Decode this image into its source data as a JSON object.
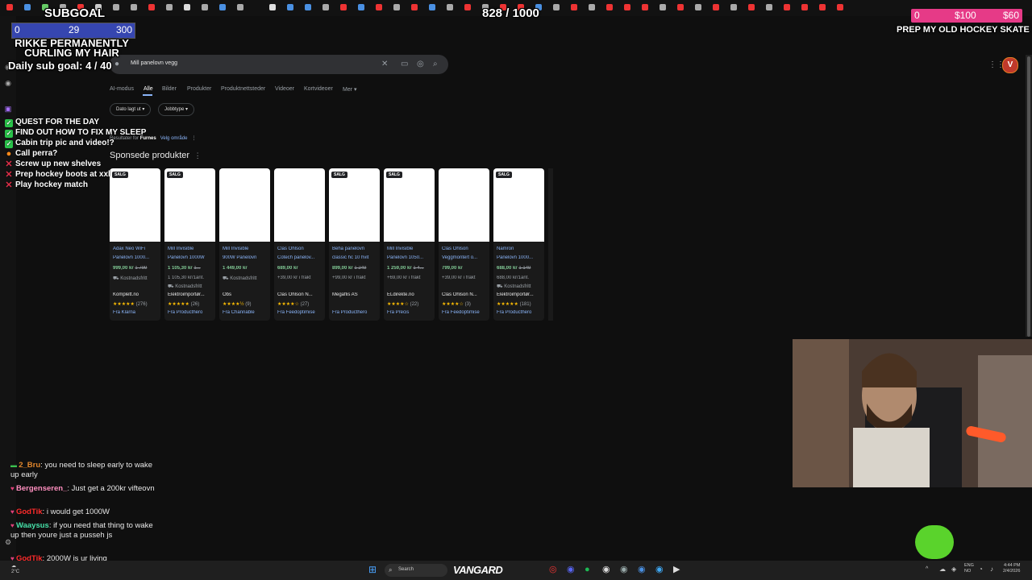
{
  "stream_overlay": {
    "subgoal_title": "SUBGOAL",
    "subgoal_start": "0",
    "subgoal_current": "29",
    "subgoal_target": "300",
    "subgoal_desc": "RIKKE PERMANENTLY CURLING MY HAIR",
    "daily_sub_goal": "Daily sub goal: 4 / 40",
    "counter": "828 / 1000",
    "donation_start": "0",
    "donation_current": "$100",
    "donation_target": "$60",
    "donation_goal_text": "PREP MY OLD HOCKEY SKATE"
  },
  "search": {
    "query": "Mill panelovn vegg",
    "tabs": [
      "AI-modus",
      "Alle",
      "Bilder",
      "Produkter",
      "Produktnettsteder",
      "Videoer",
      "Kortvideoer",
      "Mer"
    ],
    "active_tab": "Alle",
    "filters": [
      "Dato lagt ut",
      "Jobbtype"
    ],
    "location_prefix": "Resultater for",
    "location": "Furnes",
    "location_link": "Velg område",
    "sponsored_title": "Sponsede produkter"
  },
  "products": [
    {
      "sale": "SALG",
      "title1": "Adax Neo WiFi",
      "title2": "Panelovn 1000...",
      "price": "999,00 kr",
      "old": "1 799",
      "ship": "Kostnadsfritt",
      "ship2": "",
      "store": "Komplett.no",
      "stars": "★★★★★",
      "rating": "(276)",
      "from": "Fra Klarna"
    },
    {
      "sale": "SALG",
      "title1": "Mill Invisible",
      "title2": "Panelovn 1000W",
      "price": "1 105,30 kr",
      "old": "1...",
      "ship": "Kostnadsfritt",
      "ship2": "1 105,30 kr/1ant.",
      "store": "Elektroimportør...",
      "stars": "★★★★★",
      "rating": "(26)",
      "from": "Fra Producthero"
    },
    {
      "sale": "",
      "title1": "Mill Invisible",
      "title2": "900W Panelovn",
      "price": "1 449,00 kr",
      "old": "",
      "ship": "Kostnadsfritt",
      "ship2": "",
      "store": "Obs",
      "stars": "★★★★½",
      "rating": "(9)",
      "from": "Fra Channable"
    },
    {
      "sale": "",
      "title1": "Clas Ohlson",
      "title2": "Cotech panelov...",
      "price": "689,00 kr",
      "old": "",
      "ship": "+39,00 kr i frakt",
      "ship2": "",
      "store": "Clas Ohlson N...",
      "stars": "★★★★☆",
      "rating": "(27)",
      "from": "Fra Feedoptimise"
    },
    {
      "sale": "SALG",
      "title1": "Beha panelovn",
      "title2": "classic hc 10 hvit",
      "price": "899,00 kr",
      "old": "1 249",
      "ship": "+99,00 kr i frakt",
      "ship2": "",
      "store": "Megaflis AS",
      "stars": "",
      "rating": "",
      "from": "Fra Producthero"
    },
    {
      "sale": "SALG",
      "title1": "Mill Invisible",
      "title2": "Panelovn 1050...",
      "price": "1 259,00 kr",
      "old": "1 4...",
      "ship": "+69,00 kr i frakt",
      "ship2": "",
      "store": "ELdirekte.no",
      "stars": "★★★★☆",
      "rating": "(22)",
      "from": "Fra Precis"
    },
    {
      "sale": "",
      "title1": "Clas Ohlson",
      "title2": "Veggmontert o...",
      "price": "799,00 kr",
      "old": "",
      "ship": "+39,00 kr i frakt",
      "ship2": "",
      "store": "Clas Ohlson N...",
      "stars": "★★★★☆",
      "rating": "(3)",
      "from": "Fra Feedoptimise"
    },
    {
      "sale": "SALG",
      "title1": "Namron",
      "title2": "Panelovn 1000...",
      "price": "688,00 kr",
      "old": "1 149",
      "ship": "Kostnadsfritt",
      "ship2": "688,00 kr/1ant.",
      "store": "Elektroimportør...",
      "stars": "★★★★★",
      "rating": "(181)",
      "from": "Fra Producthero"
    }
  ],
  "checklist": [
    {
      "text": "QUEST FOR THE DAY",
      "state": "done"
    },
    {
      "text": "FIND OUT HOW TO FIX MY SLEEP",
      "state": "done"
    },
    {
      "text": "Cabin trip pic and video!?",
      "state": "done"
    },
    {
      "text": "Call perra?",
      "state": "pending"
    },
    {
      "text": "Screw up new shelves",
      "state": "todo"
    },
    {
      "text": "Prep hockey boots at xxl",
      "state": "todo"
    },
    {
      "text": "Play hockey match",
      "state": "todo"
    }
  ],
  "chat": [
    {
      "user": "2_Bru",
      "color": "#e0862c",
      "msg": "you need to sleep early to wake up early"
    },
    {
      "user": "Bergenseren_",
      "color": "#ff8fbf",
      "msg": "Just get a 200kr vifteovn"
    },
    {
      "user": "GodTik",
      "color": "#ff2b2b",
      "msg": "i would get 1000W"
    },
    {
      "user": "Waaysus",
      "color": "#46e0a8",
      "msg": "if you need that thing to wake up then youre just a pusseh js"
    },
    {
      "user": "GodTik",
      "color": "#ff2b2b",
      "msg": "2000W is ur living"
    }
  ],
  "taskbar": {
    "search_placeholder": "Search",
    "stream_brand": "VANGARD",
    "lang1": "ENG",
    "lang2": "NO",
    "time": "4:44 PM",
    "date": "2/4/2026",
    "weather": "2°C"
  },
  "colors": {
    "subgoal_bar": "#3646b0",
    "donation_bar": "#e63a87",
    "link": "#8ab4f8",
    "price": "#81c995"
  }
}
